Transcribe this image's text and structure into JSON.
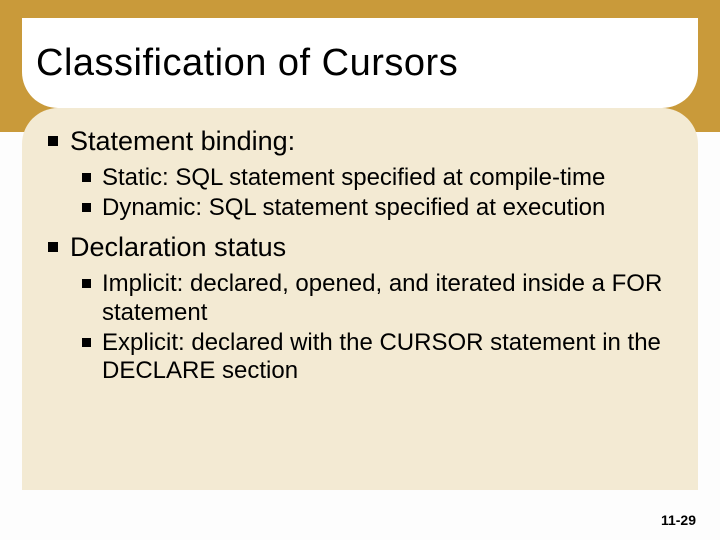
{
  "slide": {
    "title": "Classification of Cursors",
    "sections": [
      {
        "heading": "Statement binding:",
        "items": [
          "Static: SQL statement specified at compile-time",
          "Dynamic: SQL statement specified at execution"
        ]
      },
      {
        "heading": "Declaration status",
        "items": [
          "Implicit: declared, opened, and iterated inside a FOR statement",
          "Explicit: declared with the CURSOR statement in the DECLARE section"
        ]
      }
    ],
    "page_number": "11-29"
  }
}
